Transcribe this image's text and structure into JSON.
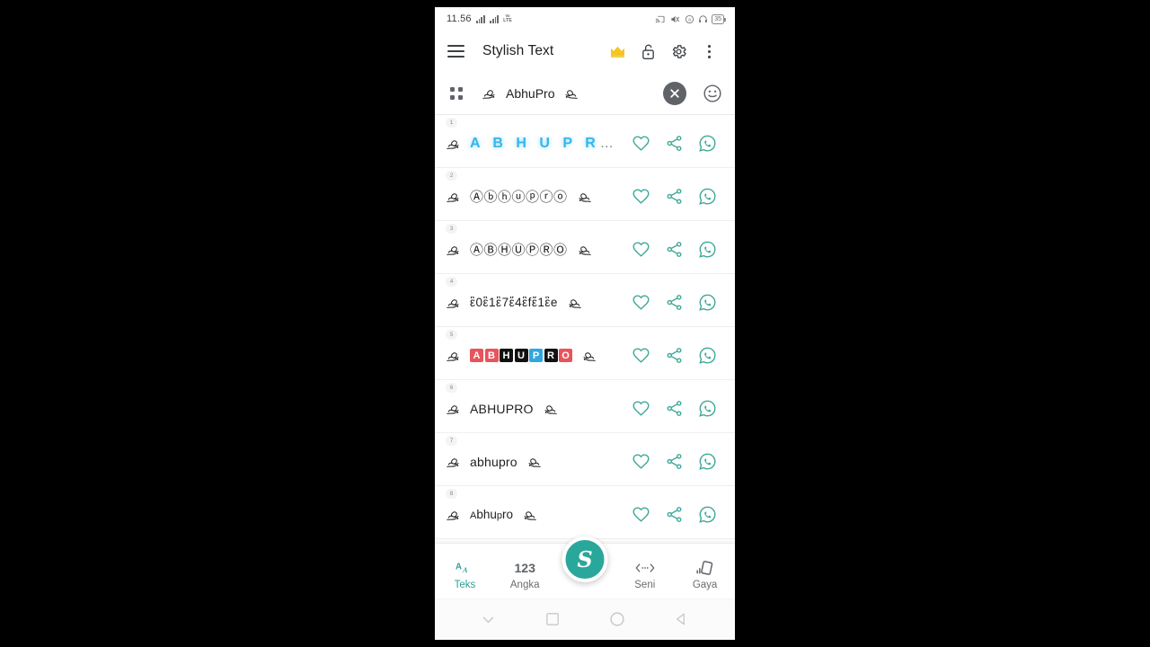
{
  "statusbar": {
    "time": "11.56",
    "network_label_top": "Vo",
    "network_label_bottom": "LTE",
    "battery_level": "35",
    "icons": [
      "cast-icon",
      "mute-icon",
      "dnd-icon",
      "headphones-icon",
      "battery-icon"
    ]
  },
  "appbar": {
    "menu_icon": "hamburger-menu-icon",
    "title": "Stylish Text",
    "crown_icon": "crown-icon",
    "lock_icon": "unlocked-padlock-icon",
    "settings_icon": "gear-icon",
    "overflow_icon": "more-vertical-icon"
  },
  "search": {
    "apps_icon": "grid-dots-icon",
    "value": "AbhuPro",
    "decoration_left": "ඞඞ",
    "decoration_right": "ඞ",
    "clear_icon": "close-circle-icon",
    "emoji_icon": "emoji-smiley-icon"
  },
  "actions": {
    "favorite": "heart-icon",
    "share": "share-nodes-icon",
    "whatsapp": "whatsapp-icon"
  },
  "results": [
    {
      "number": "1",
      "style": "glow-spaced",
      "text": "A B H U P R",
      "truncated": "…",
      "decorated": false
    },
    {
      "number": "2",
      "style": "circled",
      "text": "Ⓐⓑⓗⓤⓟⓡⓞ",
      "decorated": true
    },
    {
      "number": "3",
      "style": "circled-filled",
      "text": "ⒶⒷⒽⓊⓅⓇⓄ",
      "decorated": true
    },
    {
      "number": "4",
      "style": "squared",
      "text": "ἓ0ἓ1ἓ7ἔ4ἓfἔ1ἓe",
      "decorated": true
    },
    {
      "number": "5",
      "style": "color-boxes",
      "decorated": true,
      "letters": [
        {
          "ch": "A",
          "bg": "#e8545c"
        },
        {
          "ch": "B",
          "bg": "#e8545c"
        },
        {
          "ch": "H",
          "bg": "#111111"
        },
        {
          "ch": "U",
          "bg": "#111111"
        },
        {
          "ch": "P",
          "bg": "#2fa8e0"
        },
        {
          "ch": "R",
          "bg": "#111111"
        },
        {
          "ch": "O",
          "bg": "#e8545c"
        }
      ]
    },
    {
      "number": "6",
      "style": "plain-upper",
      "text": "ABHUPRO",
      "decorated": true
    },
    {
      "number": "7",
      "style": "plain-lower",
      "text": "abhupro",
      "decorated": true
    },
    {
      "number": "8",
      "style": "smallcaps",
      "part_a": "A",
      "part_b": "bhu",
      "part_c": "p",
      "part_d": "ro",
      "decorated": true
    }
  ],
  "bottomnav": {
    "items": [
      {
        "glyph": "Aa",
        "label": "Teks",
        "icon": "text-case-icon",
        "active": true
      },
      {
        "glyph": "123",
        "label": "Angka",
        "icon": "numbers-icon",
        "active": false
      },
      {
        "glyph": "‹···›",
        "label": "Seni",
        "icon": "art-brackets-icon",
        "active": false
      },
      {
        "glyph": "◧",
        "label": "Gaya",
        "icon": "style-card-icon",
        "active": false
      }
    ],
    "fab_icon": "stylish-s-icon",
    "fab_glyph": "S"
  },
  "sysnav": {
    "dismiss_icon": "chevron-down-icon",
    "recents_icon": "square-icon",
    "home_icon": "circle-icon",
    "back_icon": "triangle-back-icon"
  },
  "colors": {
    "accent_teal": "#2aa397",
    "glow_blue": "#35b6e8",
    "crown_gold": "#f3c623"
  }
}
